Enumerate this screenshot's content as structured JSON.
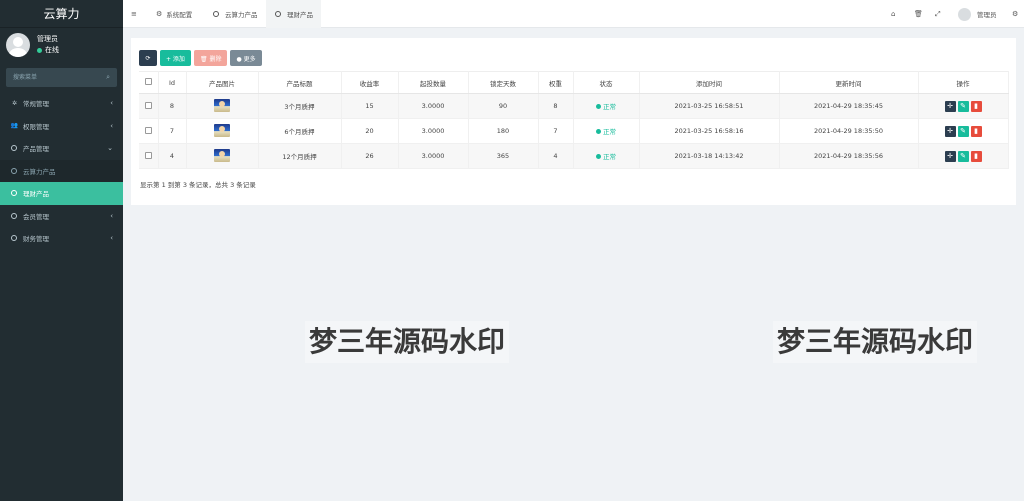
{
  "app": {
    "title": "云算力"
  },
  "user": {
    "name": "管理员",
    "status": "在线"
  },
  "search": {
    "placeholder": "搜索菜单"
  },
  "sidebar": {
    "items": [
      {
        "label": "常规管理",
        "icon": "cogs-icon"
      },
      {
        "label": "权限管理",
        "icon": "group-icon"
      },
      {
        "label": "产品管理",
        "icon": "circle-icon"
      },
      {
        "label": "云算力产品",
        "icon": "circle-icon"
      },
      {
        "label": "理财产品",
        "icon": "circle-icon"
      },
      {
        "label": "会员管理",
        "icon": "circle-icon"
      },
      {
        "label": "财务管理",
        "icon": "circle-icon"
      }
    ]
  },
  "topbar": {
    "menu_icon": "≡",
    "tabs": [
      {
        "label": "系统配置"
      },
      {
        "label": "云算力产品"
      },
      {
        "label": "理财产品"
      }
    ],
    "user_label": "管理员"
  },
  "toolbar": {
    "refresh": "⟳",
    "add_label": "+ 添加",
    "delete_label": "🗑 删除",
    "more_label": "● 更多"
  },
  "table": {
    "headers": [
      "Id",
      "产品图片",
      "产品标题",
      "收益率",
      "起投数量",
      "锁定天数",
      "权重",
      "状态",
      "添加时间",
      "更新时间",
      "操作"
    ],
    "rows": [
      {
        "id": "8",
        "title": "3个月质押",
        "rate": "15",
        "min": "3.0000",
        "days": "90",
        "weight": "8",
        "status": "正常",
        "created": "2021-03-25 16:58:51",
        "updated": "2021-04-29 18:35:45"
      },
      {
        "id": "7",
        "title": "6个月质押",
        "rate": "20",
        "min": "3.0000",
        "days": "180",
        "weight": "7",
        "status": "正常",
        "created": "2021-03-25 16:58:16",
        "updated": "2021-04-29 18:35:50"
      },
      {
        "id": "4",
        "title": "12个月质押",
        "rate": "26",
        "min": "3.0000",
        "days": "365",
        "weight": "4",
        "status": "正常",
        "created": "2021-03-18 14:13:42",
        "updated": "2021-04-29 18:35:56"
      }
    ]
  },
  "pagination": {
    "summary": "显示第 1 到第 3 条记录，总共 3 条记录"
  },
  "watermark": {
    "text": "梦三年源码水印"
  },
  "colors": {
    "sidebar": "#222d32",
    "accent": "#18bc9c",
    "danger": "#e74c3c",
    "dark": "#2c3e50"
  }
}
